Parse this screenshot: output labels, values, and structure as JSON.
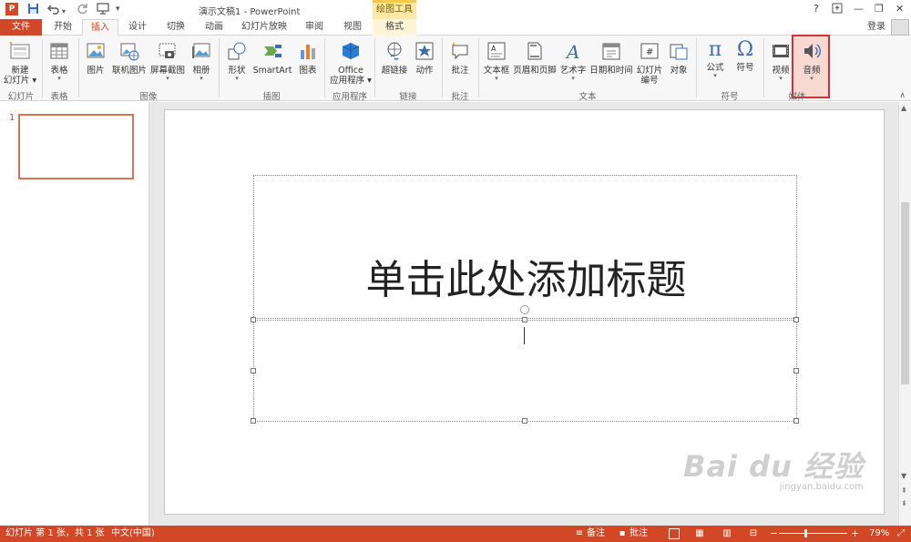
{
  "titlebar": {
    "app_icon": "P",
    "qat_save_icon": "save-icon",
    "qat_undo_icon": "undo-icon",
    "qat_redo_icon": "redo-icon",
    "qat_start_icon": "start-slideshow-icon",
    "qat_more": "▾",
    "title": "演示文稿1 - PowerPoint",
    "context_tool_header": "绘图工具",
    "help": "?",
    "restore_ribbon": "⬚",
    "minimize": "—",
    "maximize": "❐",
    "close": "✕"
  },
  "tabs": {
    "file": "文件",
    "home": "开始",
    "insert": "插入",
    "design": "设计",
    "transitions": "切换",
    "animations": "动画",
    "slideshow": "幻灯片放映",
    "review": "审阅",
    "view": "视图",
    "format": "格式",
    "login": "登录"
  },
  "ribbon": {
    "new_slide_l1": "新建",
    "new_slide_l2": "幻灯片",
    "table": "表格",
    "picture": "图片",
    "online_picture": "联机图片",
    "screenshot": "屏幕截图",
    "album": "相册",
    "shapes": "形状",
    "smartart": "SmartArt",
    "chart": "图表",
    "office_l1": "Office",
    "office_l2": "应用程序",
    "hyperlink": "超链接",
    "action": "动作",
    "comment": "批注",
    "textbox": "文本框",
    "header_footer": "页眉和页脚",
    "wordart": "艺术字",
    "date_time": "日期和时间",
    "slide_number_l1": "幻灯片",
    "slide_number_l2": "编号",
    "object": "对象",
    "equation": "公式",
    "symbol": "符号",
    "video": "视频",
    "audio": "音频",
    "equation_glyph": "π",
    "symbol_glyph": "Ω",
    "groups": {
      "slides": "幻灯片",
      "tables": "表格",
      "images": "图像",
      "illustrations": "插图",
      "apps": "应用程序",
      "links": "链接",
      "comments": "批注",
      "text": "文本",
      "symbols": "符号",
      "media": "媒体"
    }
  },
  "thumbnails": {
    "slide_number": "1"
  },
  "slide": {
    "title_placeholder": "单击此处添加标题"
  },
  "watermark": {
    "logo": "Bai du 经验",
    "url": "jingyan.baidu.com"
  },
  "statusbar": {
    "slide_info": "幻灯片 第 1 张，共 1 张",
    "language": "中文(中国)",
    "notes": "备注",
    "comments": "批注",
    "zoom_minus": "−",
    "zoom_plus": "+",
    "zoom": "79%"
  },
  "colors": {
    "accent": "#d24726",
    "highlight_box": "#d33232",
    "context_tab": "#fbe9a5"
  }
}
